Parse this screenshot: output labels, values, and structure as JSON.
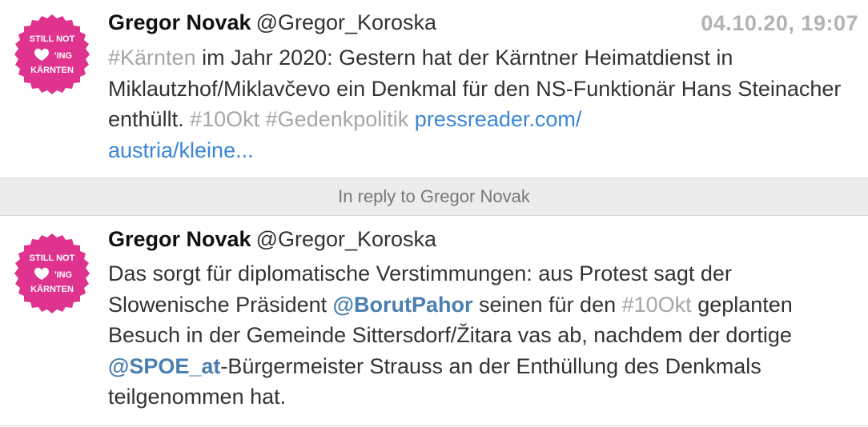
{
  "tweets": [
    {
      "name": "Gregor Novak",
      "handle": "@Gregor_Koroska",
      "time": "04.10.20, 19:07",
      "avatar_text": [
        "STILL NOT",
        "'ING",
        "KÄRNTEN"
      ],
      "body": {
        "hashtag_karnten": "#Kärnten",
        "t1": " im Jahr 2020: Gestern  hat der Kärntner Heimatdienst in Miklautzhof/Miklavčevo ein Denkmal für den NS-Funktionär Hans Steinacher enthüllt. ",
        "hashtag_10okt": "#10Okt",
        "t2": " ",
        "hashtag_gedenk": "#Gedenkpolitik",
        "t3": " ",
        "link_line1": "pressreader.com/",
        "link_line2": "austria/kleine..."
      }
    },
    {
      "name": "Gregor Novak",
      "handle": "@Gregor_Koroska",
      "avatar_text": [
        "STILL NOT",
        "'ING",
        "KÄRNTEN"
      ],
      "body": {
        "t1": "Das sorgt für diplomatische Verstimmungen: aus Protest sagt der Slowenische Präsident ",
        "mention_pahor": "@BorutPahor",
        "t2": " seinen für den ",
        "hashtag_10okt": "#10Okt",
        "t3": " geplanten Besuch in der Gemeinde Sittersdorf/Žitara vas ab, nachdem der dortige ",
        "mention_spoe": "@SPOE_at",
        "t4": "-Bürgermeister Strauss an der Enthüllung des Denkmals teilgenommen hat."
      }
    }
  ],
  "reply_bar": "In reply to Gregor Novak",
  "colors": {
    "avatar_pink": "#e0338f",
    "hashtag": "#a6a6a6",
    "link": "#3a86d4",
    "mention": "#4a7fb0",
    "timestamp": "#b3b3b3"
  }
}
